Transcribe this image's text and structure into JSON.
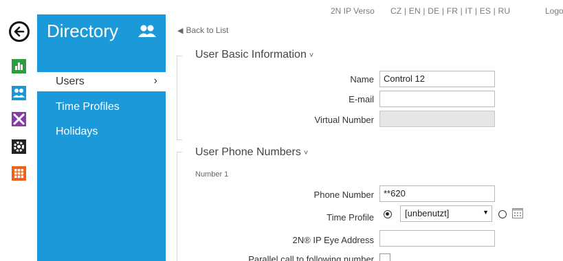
{
  "topbar": {
    "device_name": "2N IP Verso",
    "languages": "CZ | EN | DE | FR | IT | ES | RU",
    "logout_label": "Logo"
  },
  "rail": {
    "icons": [
      "back-icon",
      "status-icon",
      "directory-icon",
      "hardware-icon",
      "services-icon",
      "system-icon"
    ],
    "colors": {
      "status": "#2d9e3e",
      "directory": "#1998d8",
      "hardware": "#8b3aa9",
      "services": "#232323",
      "system": "#f06018"
    }
  },
  "sidebar": {
    "title": "Directory",
    "accent": "#1b99d9",
    "items": [
      {
        "label": "Users",
        "active": true
      },
      {
        "label": "Time Profiles",
        "active": false
      },
      {
        "label": "Holidays",
        "active": false
      }
    ]
  },
  "main": {
    "back_label": "Back to List",
    "basic": {
      "title": "User Basic Information",
      "name_label": "Name",
      "name_value": "Control 12",
      "email_label": "E-mail",
      "email_value": "",
      "vnum_label": "Virtual Number",
      "vnum_value": ""
    },
    "phones": {
      "title": "User Phone Numbers",
      "number_heading": "Number 1",
      "phone_label": "Phone Number",
      "phone_value": "**620",
      "profile_label": "Time Profile",
      "profile_value": "[unbenutzt]",
      "eye_label": "2N® IP Eye Address",
      "eye_value": "",
      "parallel_label": "Parallel call to following number"
    }
  }
}
